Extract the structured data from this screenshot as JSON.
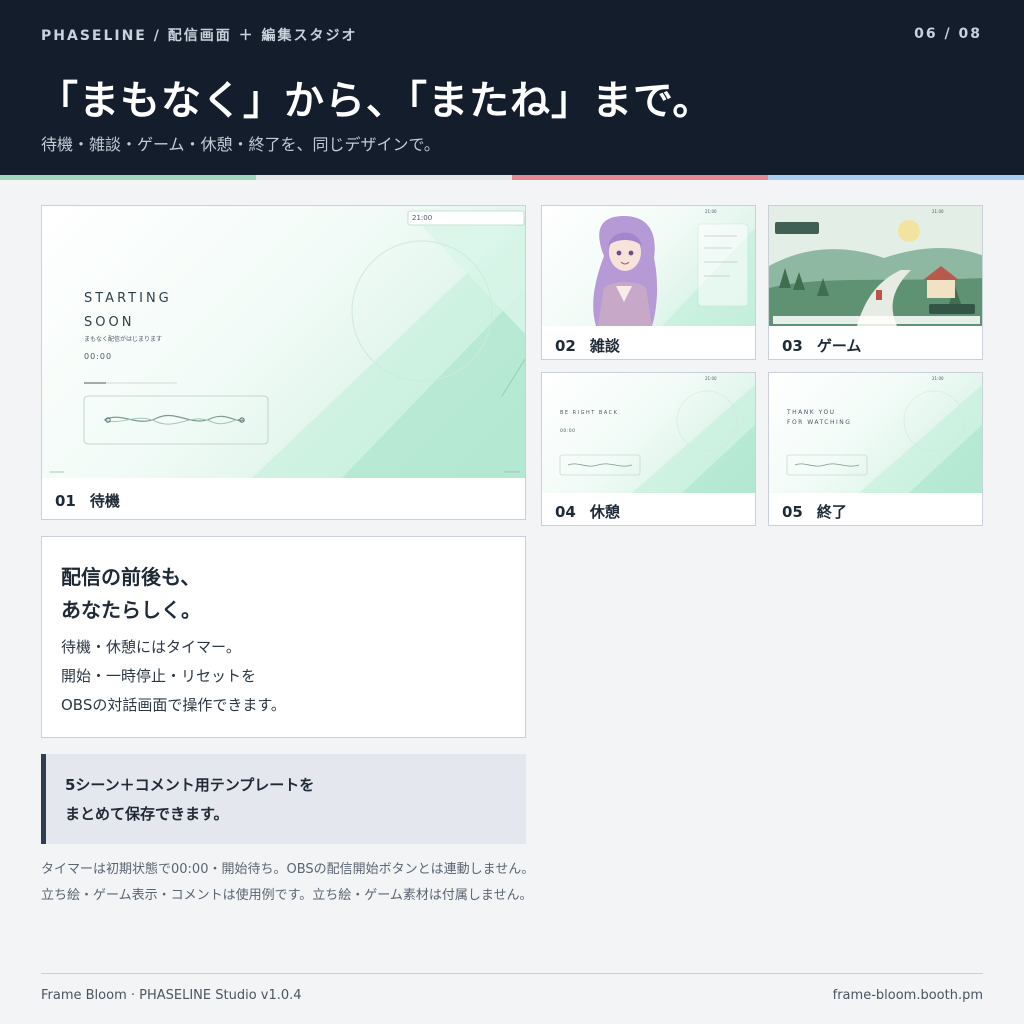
{
  "header": {
    "breadcrumb": "PHASELINE / 配信画面 ＋ 編集スタジオ",
    "pager": "06 / 08",
    "title": "「まもなく」から、「またね」まで。",
    "subtitle": "待機・雑談・ゲーム・休憩・終了を、同じデザインで。"
  },
  "stripe_colors": [
    "#9fd8b8",
    "#e4e6ea",
    "#e58a94",
    "#a9d0f0"
  ],
  "scenes": [
    {
      "num": "01",
      "label": "待機",
      "preview": {
        "title_line1": "STARTING",
        "title_line2": "SOON",
        "message": "まもなく配信がはじまります",
        "timer": "00:00",
        "clock": "21:00"
      }
    },
    {
      "num": "02",
      "label": "雑談",
      "preview": {
        "clock": "21:00"
      }
    },
    {
      "num": "03",
      "label": "ゲーム",
      "preview": {
        "clock": "21:00"
      }
    },
    {
      "num": "04",
      "label": "休憩",
      "preview": {
        "title": "BE RIGHT BACK",
        "timer": "00:00",
        "clock": "21:00"
      }
    },
    {
      "num": "05",
      "label": "終了",
      "preview": {
        "title_line1": "THANK YOU",
        "title_line2": "FOR WATCHING",
        "clock": "21:00"
      }
    }
  ],
  "info": {
    "title_line1": "配信の前後も、",
    "title_line2": "あなたらしく。",
    "body_line1": "待機・休憩にはタイマー。",
    "body_line2": "開始・一時停止・リセットを",
    "body_line3": "OBSの対話画面で操作できます。"
  },
  "note": {
    "line1": "5シーン＋コメント用テンプレートを",
    "line2": "まとめて保存できます。"
  },
  "footnote": {
    "line1": "タイマーは初期状態で00:00・開始待ち。OBSの配信開始ボタンとは連動しません。",
    "line2": "立ち絵・ゲーム表示・コメントは使用例です。立ち絵・ゲーム素材は付属しません。"
  },
  "footer": {
    "left": "Frame Bloom · PHASELINE Studio v1.0.4",
    "right": "frame-bloom.booth.pm"
  }
}
